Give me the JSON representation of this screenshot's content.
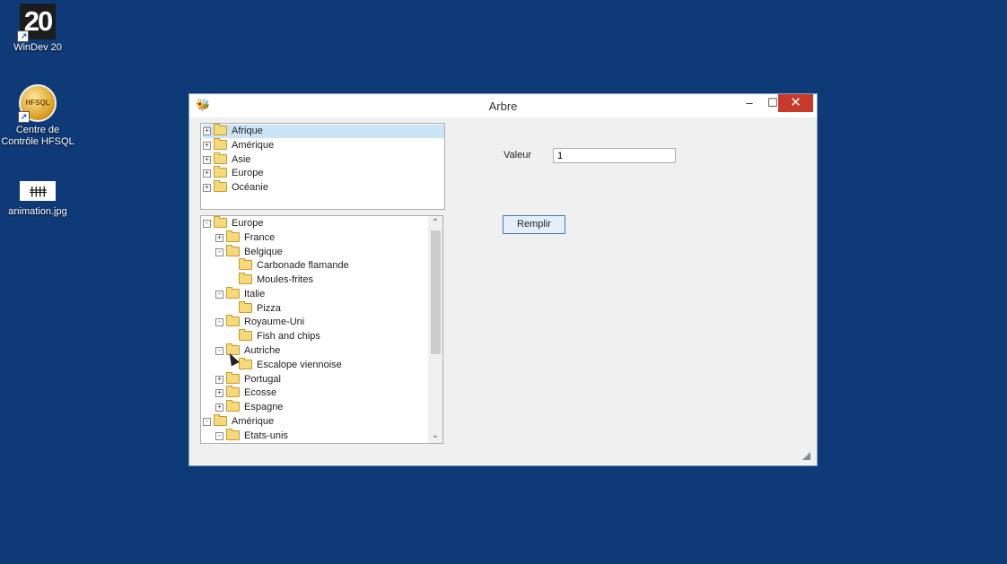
{
  "desktop": {
    "icons": [
      {
        "label": "WinDev 20",
        "glyph": "20",
        "icon": "windev-icon"
      },
      {
        "label": "Centre de Contrôle HFSQL",
        "glyph": "HFSQL",
        "icon": "hfsql-icon"
      },
      {
        "label": "animation.jpg",
        "glyph": "ǂǂǂǂ",
        "icon": "image-file-icon"
      }
    ],
    "background_color": "#0e3b78"
  },
  "window": {
    "title": "Arbre",
    "controls": {
      "minimize": "–",
      "maximize": "☐",
      "close": "✕"
    },
    "tree_top": {
      "items": [
        {
          "label": "Afrique",
          "selected": true
        },
        {
          "label": "Amérique"
        },
        {
          "label": "Asie"
        },
        {
          "label": "Europe"
        },
        {
          "label": "Océanie"
        }
      ]
    },
    "tree_bottom": {
      "items": [
        {
          "label": "Europe",
          "toggle": "-"
        },
        {
          "label": "France",
          "toggle": "+"
        },
        {
          "label": "Belgique",
          "toggle": "-"
        },
        {
          "label": "Carbonade flamande",
          "toggle": ""
        },
        {
          "label": "Moules-frites",
          "toggle": ""
        },
        {
          "label": "Italie",
          "toggle": "-"
        },
        {
          "label": "Pizza",
          "toggle": ""
        },
        {
          "label": "Royaume-Uni",
          "toggle": "-"
        },
        {
          "label": "Fish and chips",
          "toggle": ""
        },
        {
          "label": "Autriche",
          "toggle": "-"
        },
        {
          "label": "Escalope viennoise",
          "toggle": ""
        },
        {
          "label": "Portugal",
          "toggle": "+"
        },
        {
          "label": "Ecosse",
          "toggle": "+"
        },
        {
          "label": "Espagne",
          "toggle": "+"
        },
        {
          "label": "Amérique",
          "toggle": "-"
        },
        {
          "label": "Etats-unis",
          "toggle": "-"
        }
      ],
      "scroll_up": "⌃",
      "scroll_down": "⌄"
    },
    "valeur": {
      "label": "Valeur",
      "value": "1"
    },
    "remplir_button": "Remplir"
  }
}
